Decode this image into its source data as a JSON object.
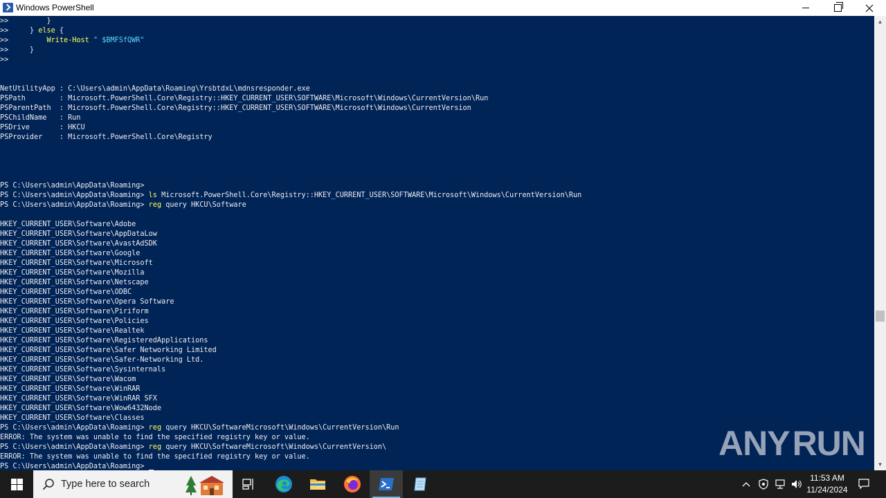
{
  "window": {
    "title": "Windows PowerShell",
    "icon": "powershell-icon"
  },
  "console": {
    "lines": [
      {
        "text": ">>         }"
      },
      {
        "text": ">>     } ",
        "kw": "else",
        "rest": " {"
      },
      {
        "text": ">>         ",
        "cmd": "Write-Host",
        "rest": " ",
        "str": "\" $BMFSfQWR\""
      },
      {
        "text": ">>     }"
      },
      {
        "text": ">>"
      },
      {
        "text": ""
      },
      {
        "text": ""
      },
      {
        "text": "NetUtilityApp : C:\\Users\\admin\\AppData\\Roaming\\YrsbtdxL\\mdnsresponder.exe"
      },
      {
        "text": "PSPath        : Microsoft.PowerShell.Core\\Registry::HKEY_CURRENT_USER\\SOFTWARE\\Microsoft\\Windows\\CurrentVersion\\Run"
      },
      {
        "text": "PSParentPath  : Microsoft.PowerShell.Core\\Registry::HKEY_CURRENT_USER\\SOFTWARE\\Microsoft\\Windows\\CurrentVersion"
      },
      {
        "text": "PSChildName   : Run"
      },
      {
        "text": "PSDrive       : HKCU"
      },
      {
        "text": "PSProvider    : Microsoft.PowerShell.Core\\Registry"
      },
      {
        "text": ""
      },
      {
        "text": ""
      },
      {
        "text": ""
      },
      {
        "text": ""
      },
      {
        "text": "PS C:\\Users\\admin\\AppData\\Roaming>"
      },
      {
        "text": "PS C:\\Users\\admin\\AppData\\Roaming> ",
        "cmd": "ls",
        "rest": " Microsoft.PowerShell.Core\\Registry::HKEY_CURRENT_USER\\SOFTWARE\\Microsoft\\Windows\\CurrentVersion\\Run"
      },
      {
        "text": "PS C:\\Users\\admin\\AppData\\Roaming> ",
        "cmd": "reg",
        "rest": " query HKCU\\Software"
      },
      {
        "text": ""
      },
      {
        "text": "HKEY_CURRENT_USER\\Software\\Adobe"
      },
      {
        "text": "HKEY_CURRENT_USER\\Software\\AppDataLow"
      },
      {
        "text": "HKEY_CURRENT_USER\\Software\\AvastAdSDK"
      },
      {
        "text": "HKEY_CURRENT_USER\\Software\\Google"
      },
      {
        "text": "HKEY_CURRENT_USER\\Software\\Microsoft"
      },
      {
        "text": "HKEY_CURRENT_USER\\Software\\Mozilla"
      },
      {
        "text": "HKEY_CURRENT_USER\\Software\\Netscape"
      },
      {
        "text": "HKEY_CURRENT_USER\\Software\\ODBC"
      },
      {
        "text": "HKEY_CURRENT_USER\\Software\\Opera Software"
      },
      {
        "text": "HKEY_CURRENT_USER\\Software\\Piriform"
      },
      {
        "text": "HKEY_CURRENT_USER\\Software\\Policies"
      },
      {
        "text": "HKEY_CURRENT_USER\\Software\\Realtek"
      },
      {
        "text": "HKEY_CURRENT_USER\\Software\\RegisteredApplications"
      },
      {
        "text": "HKEY_CURRENT_USER\\Software\\Safer Networking Limited"
      },
      {
        "text": "HKEY_CURRENT_USER\\Software\\Safer-Networking Ltd."
      },
      {
        "text": "HKEY_CURRENT_USER\\Software\\Sysinternals"
      },
      {
        "text": "HKEY_CURRENT_USER\\Software\\Wacom"
      },
      {
        "text": "HKEY_CURRENT_USER\\Software\\WinRAR"
      },
      {
        "text": "HKEY_CURRENT_USER\\Software\\WinRAR SFX"
      },
      {
        "text": "HKEY_CURRENT_USER\\Software\\Wow6432Node"
      },
      {
        "text": "HKEY_CURRENT_USER\\Software\\Classes"
      },
      {
        "text": "PS C:\\Users\\admin\\AppData\\Roaming> ",
        "cmd": "reg",
        "rest": " query HKCU\\SoftwareMicrosoft\\Windows\\CurrentVersion\\Run"
      },
      {
        "text": "ERROR: The system was unable to find the specified registry key or value."
      },
      {
        "text": "PS C:\\Users\\admin\\AppData\\Roaming> ",
        "cmd": "reg",
        "rest": " query HKCU\\SoftwareMicrosoft\\Windows\\CurrentVersion\\"
      },
      {
        "text": "ERROR: The system was unable to find the specified registry key or value."
      },
      {
        "text": "PS C:\\Users\\admin\\AppData\\Roaming> ",
        "cursor": true
      }
    ]
  },
  "watermark": {
    "left": "ANY",
    "right": "RUN"
  },
  "taskbar": {
    "search_placeholder": "Type here to search",
    "apps": [
      "task-view",
      "edge",
      "file-explorer",
      "firefox",
      "powershell",
      "notepad"
    ],
    "clock_time": "11:53 AM",
    "clock_date": "11/24/2024"
  },
  "colors": {
    "console_bg": "#012456",
    "console_fg": "#eeedf0",
    "keyword": "#ffff5f",
    "string": "#5fd7ff",
    "taskbar": "#1c1c1c"
  }
}
